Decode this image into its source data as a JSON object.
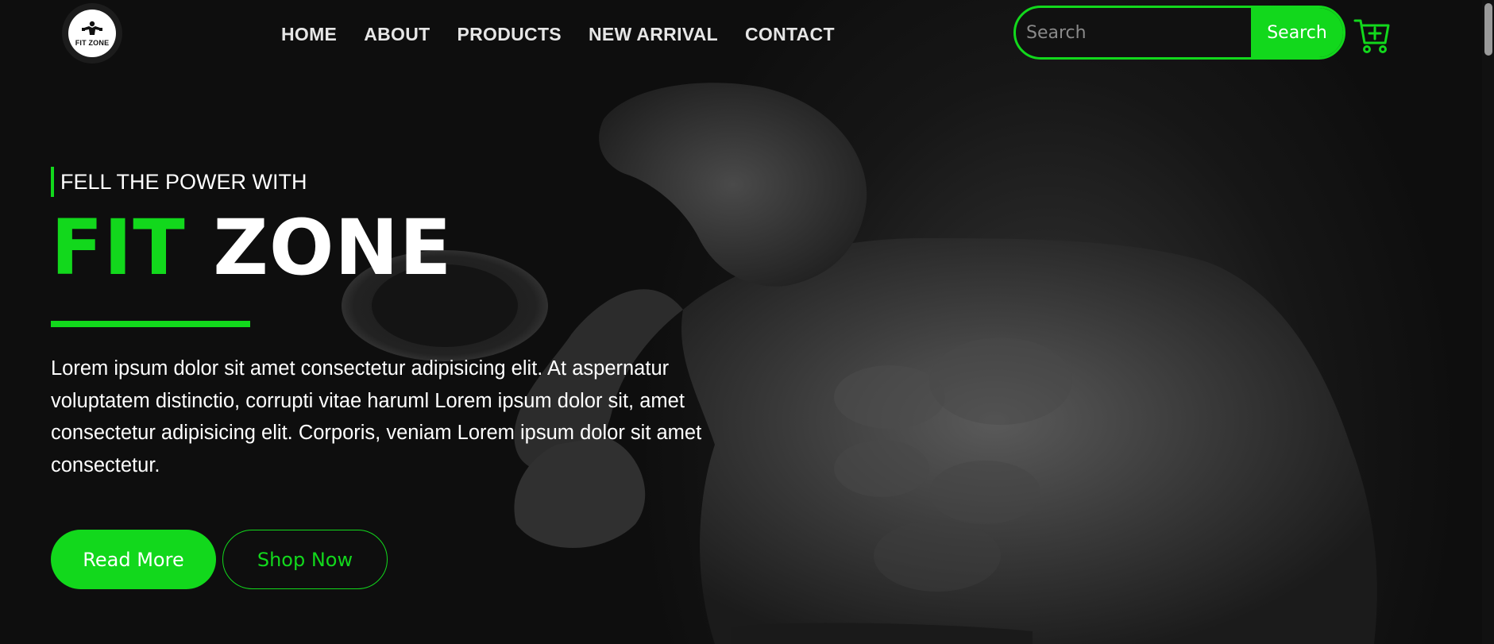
{
  "brand": {
    "logo_text": "FIT ZONE",
    "accent_color": "#12d81c"
  },
  "nav": {
    "items": [
      {
        "label": "HOME"
      },
      {
        "label": "ABOUT"
      },
      {
        "label": "PRODUCTS"
      },
      {
        "label": "NEW ARRIVAL"
      },
      {
        "label": "CONTACT"
      }
    ]
  },
  "search": {
    "placeholder": "Search",
    "value": "",
    "button_label": "Search"
  },
  "cart": {
    "icon": "cart-plus-icon"
  },
  "hero": {
    "eyebrow": "FELL THE POWER WITH",
    "title_accent": "FIT",
    "title_rest": "ZONE",
    "description": "Lorem ipsum dolor sit amet consectetur adipisicing elit. At aspernatur voluptatem distinctio, corrupti vitae haruml Lorem ipsum dolor sit, amet consectetur adipisicing elit. Corporis, veniam Lorem ipsum dolor sit amet consectetur.",
    "primary_button": "Read More",
    "secondary_button": "Shop Now"
  }
}
